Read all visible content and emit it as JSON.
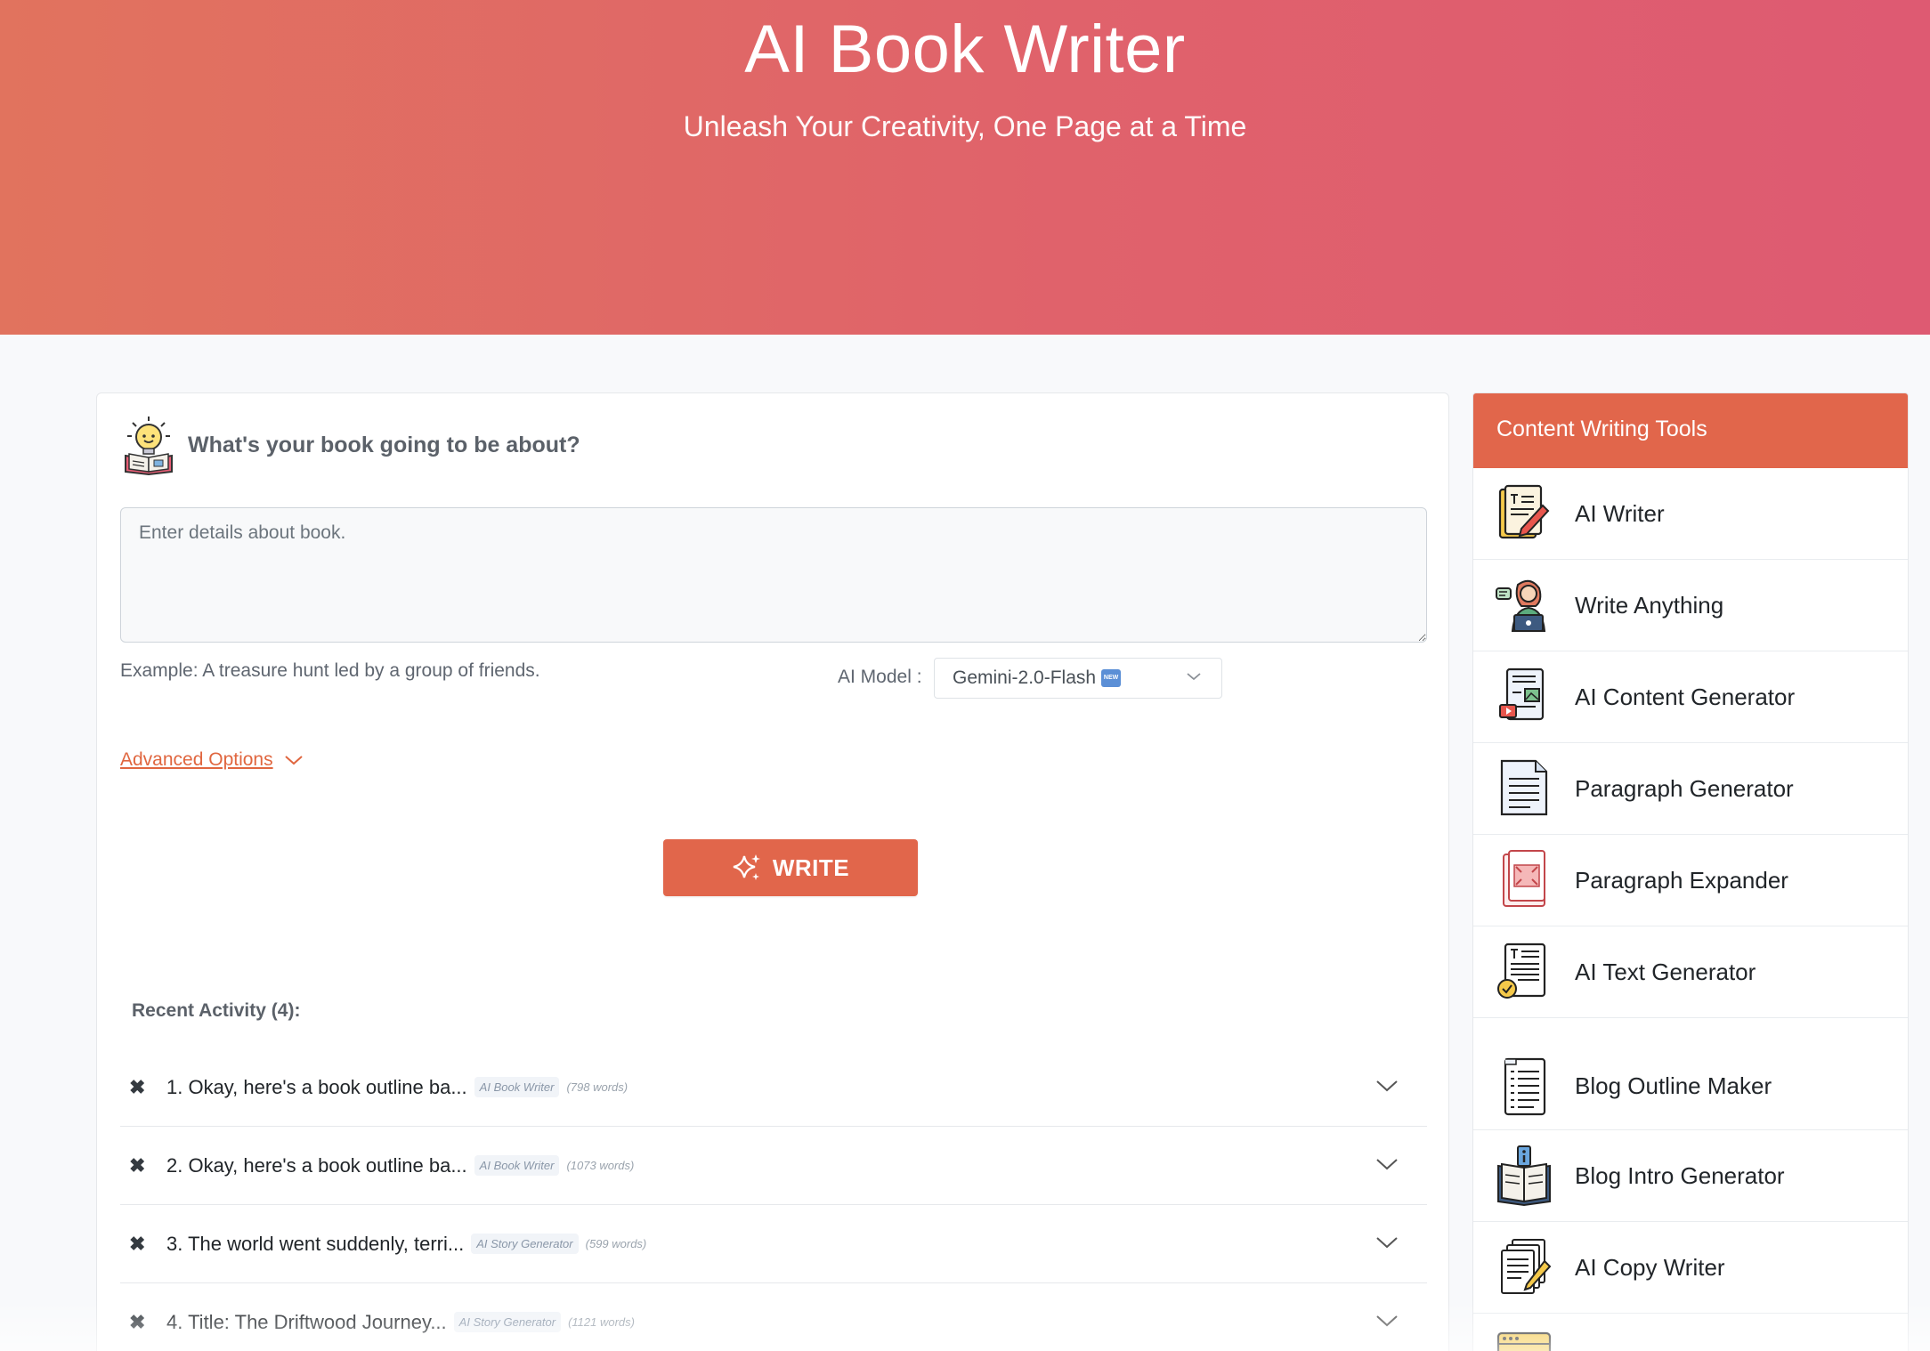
{
  "hero": {
    "title": "AI Book Writer",
    "subtitle": "Unleash Your Creativity, One Page at a Time"
  },
  "form": {
    "prompt_label": "What's your book going to be about?",
    "textarea_placeholder": "Enter details about book.",
    "example_text": "Example: A treasure hunt led by a group of friends.",
    "model_label": "AI Model :",
    "model_value": "Gemini-2.0-Flash",
    "model_badge": "NEW",
    "advanced_label": "Advanced Options",
    "write_label": "WRITE"
  },
  "recent": {
    "title": "Recent Activity (4):",
    "items": [
      {
        "title": "1. Okay, here's a book outline ba...",
        "tool": "AI Book Writer",
        "words": "(798 words)"
      },
      {
        "title": "2. Okay, here's a book outline ba...",
        "tool": "AI Book Writer",
        "words": "(1073 words)"
      },
      {
        "title": "3. The world went suddenly, terri...",
        "tool": "AI Story Generator",
        "words": "(599 words)"
      },
      {
        "title": "4. Title: The Driftwood Journey...",
        "tool": "AI Story Generator",
        "words": "(1121 words)"
      }
    ]
  },
  "sidebar": {
    "title": "Content Writing Tools",
    "tools": [
      {
        "name": "AI Writer",
        "icon": "notepad-pencil-icon"
      },
      {
        "name": "Write Anything",
        "icon": "person-laptop-icon"
      },
      {
        "name": "AI Content Generator",
        "icon": "content-document-icon"
      },
      {
        "name": "Paragraph Generator",
        "icon": "lined-paper-icon"
      },
      {
        "name": "Paragraph Expander",
        "icon": "expand-document-icon"
      },
      {
        "name": "AI Text Generator",
        "icon": "text-document-check-icon"
      },
      {
        "name": "Blog Outline Maker",
        "icon": "outline-list-icon"
      },
      {
        "name": "Blog Intro Generator",
        "icon": "open-book-info-icon"
      },
      {
        "name": "AI Copy Writer",
        "icon": "stacked-pages-pen-icon"
      }
    ]
  },
  "colors": {
    "accent": "#e1664b",
    "hero_start": "#e1735e",
    "hero_end": "#de5a72",
    "link": "#e0663f"
  }
}
